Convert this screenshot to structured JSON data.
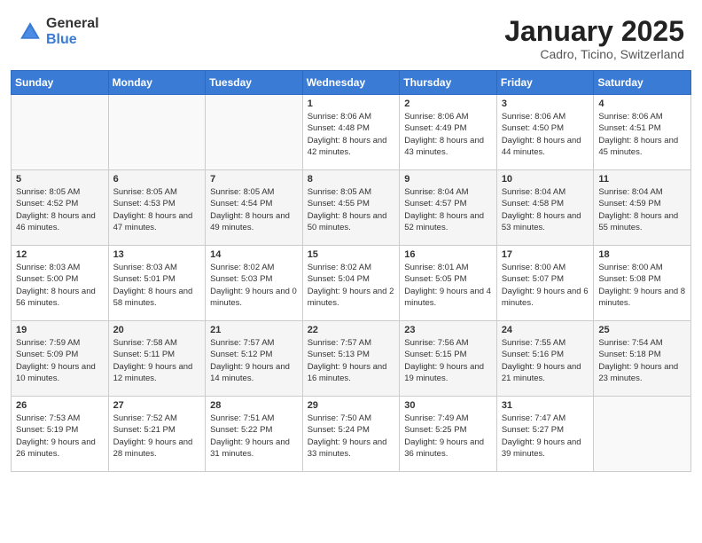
{
  "header": {
    "logo_general": "General",
    "logo_blue": "Blue",
    "title": "January 2025",
    "subtitle": "Cadro, Ticino, Switzerland"
  },
  "days_of_week": [
    "Sunday",
    "Monday",
    "Tuesday",
    "Wednesday",
    "Thursday",
    "Friday",
    "Saturday"
  ],
  "weeks": [
    [
      {
        "day": "",
        "sunrise": "",
        "sunset": "",
        "daylight": ""
      },
      {
        "day": "",
        "sunrise": "",
        "sunset": "",
        "daylight": ""
      },
      {
        "day": "",
        "sunrise": "",
        "sunset": "",
        "daylight": ""
      },
      {
        "day": "1",
        "sunrise": "Sunrise: 8:06 AM",
        "sunset": "Sunset: 4:48 PM",
        "daylight": "Daylight: 8 hours and 42 minutes."
      },
      {
        "day": "2",
        "sunrise": "Sunrise: 8:06 AM",
        "sunset": "Sunset: 4:49 PM",
        "daylight": "Daylight: 8 hours and 43 minutes."
      },
      {
        "day": "3",
        "sunrise": "Sunrise: 8:06 AM",
        "sunset": "Sunset: 4:50 PM",
        "daylight": "Daylight: 8 hours and 44 minutes."
      },
      {
        "day": "4",
        "sunrise": "Sunrise: 8:06 AM",
        "sunset": "Sunset: 4:51 PM",
        "daylight": "Daylight: 8 hours and 45 minutes."
      }
    ],
    [
      {
        "day": "5",
        "sunrise": "Sunrise: 8:05 AM",
        "sunset": "Sunset: 4:52 PM",
        "daylight": "Daylight: 8 hours and 46 minutes."
      },
      {
        "day": "6",
        "sunrise": "Sunrise: 8:05 AM",
        "sunset": "Sunset: 4:53 PM",
        "daylight": "Daylight: 8 hours and 47 minutes."
      },
      {
        "day": "7",
        "sunrise": "Sunrise: 8:05 AM",
        "sunset": "Sunset: 4:54 PM",
        "daylight": "Daylight: 8 hours and 49 minutes."
      },
      {
        "day": "8",
        "sunrise": "Sunrise: 8:05 AM",
        "sunset": "Sunset: 4:55 PM",
        "daylight": "Daylight: 8 hours and 50 minutes."
      },
      {
        "day": "9",
        "sunrise": "Sunrise: 8:04 AM",
        "sunset": "Sunset: 4:57 PM",
        "daylight": "Daylight: 8 hours and 52 minutes."
      },
      {
        "day": "10",
        "sunrise": "Sunrise: 8:04 AM",
        "sunset": "Sunset: 4:58 PM",
        "daylight": "Daylight: 8 hours and 53 minutes."
      },
      {
        "day": "11",
        "sunrise": "Sunrise: 8:04 AM",
        "sunset": "Sunset: 4:59 PM",
        "daylight": "Daylight: 8 hours and 55 minutes."
      }
    ],
    [
      {
        "day": "12",
        "sunrise": "Sunrise: 8:03 AM",
        "sunset": "Sunset: 5:00 PM",
        "daylight": "Daylight: 8 hours and 56 minutes."
      },
      {
        "day": "13",
        "sunrise": "Sunrise: 8:03 AM",
        "sunset": "Sunset: 5:01 PM",
        "daylight": "Daylight: 8 hours and 58 minutes."
      },
      {
        "day": "14",
        "sunrise": "Sunrise: 8:02 AM",
        "sunset": "Sunset: 5:03 PM",
        "daylight": "Daylight: 9 hours and 0 minutes."
      },
      {
        "day": "15",
        "sunrise": "Sunrise: 8:02 AM",
        "sunset": "Sunset: 5:04 PM",
        "daylight": "Daylight: 9 hours and 2 minutes."
      },
      {
        "day": "16",
        "sunrise": "Sunrise: 8:01 AM",
        "sunset": "Sunset: 5:05 PM",
        "daylight": "Daylight: 9 hours and 4 minutes."
      },
      {
        "day": "17",
        "sunrise": "Sunrise: 8:00 AM",
        "sunset": "Sunset: 5:07 PM",
        "daylight": "Daylight: 9 hours and 6 minutes."
      },
      {
        "day": "18",
        "sunrise": "Sunrise: 8:00 AM",
        "sunset": "Sunset: 5:08 PM",
        "daylight": "Daylight: 9 hours and 8 minutes."
      }
    ],
    [
      {
        "day": "19",
        "sunrise": "Sunrise: 7:59 AM",
        "sunset": "Sunset: 5:09 PM",
        "daylight": "Daylight: 9 hours and 10 minutes."
      },
      {
        "day": "20",
        "sunrise": "Sunrise: 7:58 AM",
        "sunset": "Sunset: 5:11 PM",
        "daylight": "Daylight: 9 hours and 12 minutes."
      },
      {
        "day": "21",
        "sunrise": "Sunrise: 7:57 AM",
        "sunset": "Sunset: 5:12 PM",
        "daylight": "Daylight: 9 hours and 14 minutes."
      },
      {
        "day": "22",
        "sunrise": "Sunrise: 7:57 AM",
        "sunset": "Sunset: 5:13 PM",
        "daylight": "Daylight: 9 hours and 16 minutes."
      },
      {
        "day": "23",
        "sunrise": "Sunrise: 7:56 AM",
        "sunset": "Sunset: 5:15 PM",
        "daylight": "Daylight: 9 hours and 19 minutes."
      },
      {
        "day": "24",
        "sunrise": "Sunrise: 7:55 AM",
        "sunset": "Sunset: 5:16 PM",
        "daylight": "Daylight: 9 hours and 21 minutes."
      },
      {
        "day": "25",
        "sunrise": "Sunrise: 7:54 AM",
        "sunset": "Sunset: 5:18 PM",
        "daylight": "Daylight: 9 hours and 23 minutes."
      }
    ],
    [
      {
        "day": "26",
        "sunrise": "Sunrise: 7:53 AM",
        "sunset": "Sunset: 5:19 PM",
        "daylight": "Daylight: 9 hours and 26 minutes."
      },
      {
        "day": "27",
        "sunrise": "Sunrise: 7:52 AM",
        "sunset": "Sunset: 5:21 PM",
        "daylight": "Daylight: 9 hours and 28 minutes."
      },
      {
        "day": "28",
        "sunrise": "Sunrise: 7:51 AM",
        "sunset": "Sunset: 5:22 PM",
        "daylight": "Daylight: 9 hours and 31 minutes."
      },
      {
        "day": "29",
        "sunrise": "Sunrise: 7:50 AM",
        "sunset": "Sunset: 5:24 PM",
        "daylight": "Daylight: 9 hours and 33 minutes."
      },
      {
        "day": "30",
        "sunrise": "Sunrise: 7:49 AM",
        "sunset": "Sunset: 5:25 PM",
        "daylight": "Daylight: 9 hours and 36 minutes."
      },
      {
        "day": "31",
        "sunrise": "Sunrise: 7:47 AM",
        "sunset": "Sunset: 5:27 PM",
        "daylight": "Daylight: 9 hours and 39 minutes."
      },
      {
        "day": "",
        "sunrise": "",
        "sunset": "",
        "daylight": ""
      }
    ]
  ]
}
